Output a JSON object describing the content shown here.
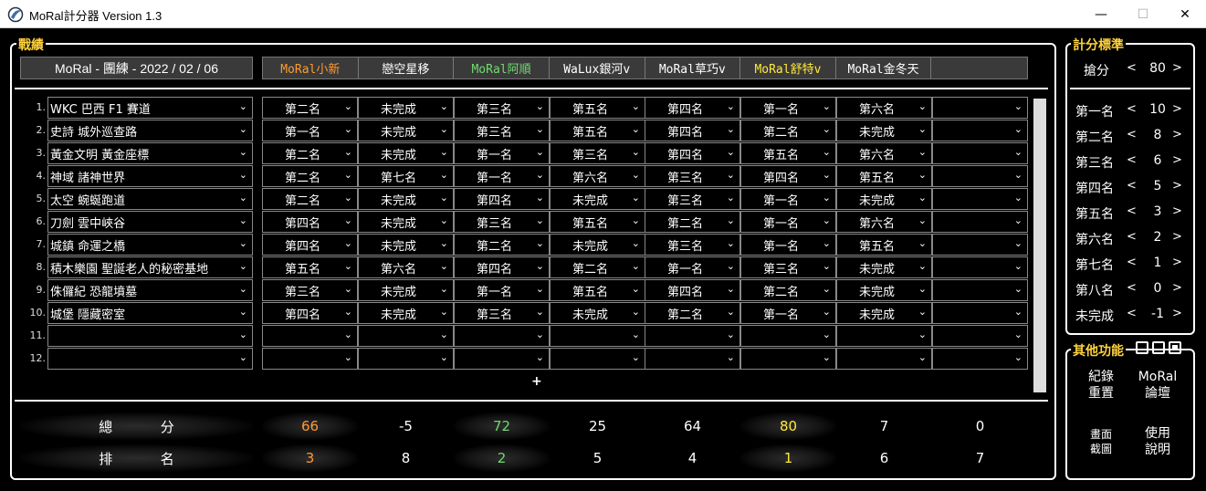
{
  "window": {
    "title": "MoRal計分器 Version 1.3",
    "controls": {
      "minimize": "—",
      "maximize": "☐",
      "close": "✕"
    }
  },
  "colors": {
    "orange": "#ff9a2e",
    "green": "#6fdc6f",
    "yellow": "#ffe93c",
    "white": "#ffffff",
    "title": "#ffd23c"
  },
  "record": {
    "title": "戰績",
    "header": "MoRal - 團練 - 2022 / 02 / 06",
    "players": [
      {
        "name": "MoRal小新",
        "color": "#ff9a2e"
      },
      {
        "name": "戀空星移",
        "color": "#ffffff"
      },
      {
        "name": "MoRal阿順",
        "color": "#6fdc6f"
      },
      {
        "name": "WaLux銀河v",
        "color": "#ffffff"
      },
      {
        "name": "MoRal草巧v",
        "color": "#ffffff"
      },
      {
        "name": "MoRal舒特v",
        "color": "#ffe93c"
      },
      {
        "name": "MoRal金冬天",
        "color": "#ffffff"
      },
      {
        "name": "",
        "color": "#ffffff"
      }
    ],
    "rows": [
      {
        "num": "1.",
        "map": "WKC 巴西 F1 賽道",
        "ranks": [
          "第二名",
          "未完成",
          "第三名",
          "第五名",
          "第四名",
          "第一名",
          "第六名",
          ""
        ]
      },
      {
        "num": "2.",
        "map": "史詩 城外巡查路",
        "ranks": [
          "第一名",
          "未完成",
          "第三名",
          "第五名",
          "第四名",
          "第二名",
          "未完成",
          ""
        ]
      },
      {
        "num": "3.",
        "map": "黃金文明 黃金座標",
        "ranks": [
          "第二名",
          "未完成",
          "第一名",
          "第三名",
          "第四名",
          "第五名",
          "第六名",
          ""
        ]
      },
      {
        "num": "4.",
        "map": "神域 諸神世界",
        "ranks": [
          "第二名",
          "第七名",
          "第一名",
          "第六名",
          "第三名",
          "第四名",
          "第五名",
          ""
        ]
      },
      {
        "num": "5.",
        "map": "太空 蜿蜒跑道",
        "ranks": [
          "第二名",
          "未完成",
          "第四名",
          "未完成",
          "第三名",
          "第一名",
          "未完成",
          ""
        ]
      },
      {
        "num": "6.",
        "map": "刀劍 雲中峽谷",
        "ranks": [
          "第四名",
          "未完成",
          "第三名",
          "第五名",
          "第二名",
          "第一名",
          "第六名",
          ""
        ]
      },
      {
        "num": "7.",
        "map": "城鎮 命運之橋",
        "ranks": [
          "第四名",
          "未完成",
          "第二名",
          "未完成",
          "第三名",
          "第一名",
          "第五名",
          ""
        ]
      },
      {
        "num": "8.",
        "map": "積木樂園 聖誕老人的秘密基地",
        "ranks": [
          "第五名",
          "第六名",
          "第四名",
          "第二名",
          "第一名",
          "第三名",
          "未完成",
          ""
        ]
      },
      {
        "num": "9.",
        "map": "侏儸紀 恐龍墳墓",
        "ranks": [
          "第三名",
          "未完成",
          "第一名",
          "第五名",
          "第四名",
          "第二名",
          "未完成",
          ""
        ]
      },
      {
        "num": "10.",
        "map": "城堡 隱藏密室",
        "ranks": [
          "第四名",
          "未完成",
          "第三名",
          "未完成",
          "第二名",
          "第一名",
          "未完成",
          ""
        ]
      },
      {
        "num": "11.",
        "map": "",
        "ranks": [
          "",
          "",
          "",
          "",
          "",
          "",
          "",
          ""
        ]
      },
      {
        "num": "12.",
        "map": "",
        "ranks": [
          "",
          "",
          "",
          "",
          "",
          "",
          "",
          ""
        ]
      }
    ],
    "add_label": "+",
    "total_label": [
      "總",
      "分"
    ],
    "rank_label": [
      "排",
      "名"
    ],
    "totals": [
      "66",
      "-5",
      "72",
      "25",
      "64",
      "80",
      "7",
      "0"
    ],
    "standings": [
      "3",
      "8",
      "2",
      "5",
      "4",
      "1",
      "6",
      "7"
    ]
  },
  "scoring": {
    "title": "計分標準",
    "grab": {
      "label": "搶分",
      "value": "80"
    },
    "items": [
      {
        "label": "第一名",
        "value": "10"
      },
      {
        "label": "第二名",
        "value": "8"
      },
      {
        "label": "第三名",
        "value": "6"
      },
      {
        "label": "第四名",
        "value": "5"
      },
      {
        "label": "第五名",
        "value": "3"
      },
      {
        "label": "第六名",
        "value": "2"
      },
      {
        "label": "第七名",
        "value": "1"
      },
      {
        "label": "第八名",
        "value": "0"
      },
      {
        "label": "未完成",
        "value": "-1"
      }
    ],
    "dec": "<",
    "inc": ">"
  },
  "functions": {
    "title": "其他功能",
    "buttons": [
      {
        "line1": "紀錄",
        "line2": "重置"
      },
      {
        "line1": "MoRal",
        "line2": "論壇"
      },
      {
        "line1": "畫面",
        "line2": "截圖"
      },
      {
        "line1": "使用",
        "line2": "說明"
      }
    ]
  }
}
